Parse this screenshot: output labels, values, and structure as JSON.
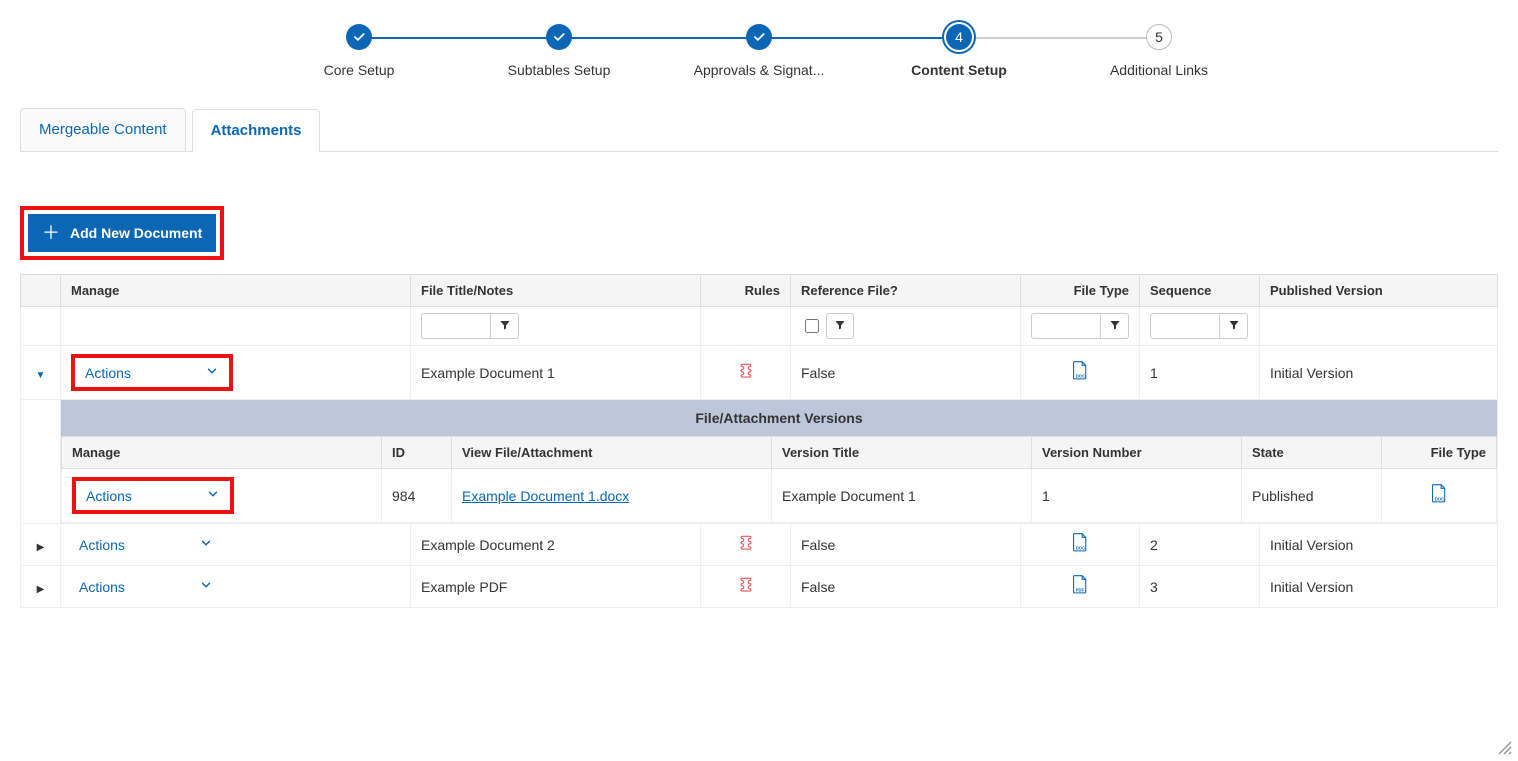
{
  "stepper": {
    "steps": [
      {
        "label": "Core Setup",
        "state": "done"
      },
      {
        "label": "Subtables Setup",
        "state": "done"
      },
      {
        "label": "Approvals & Signat...",
        "state": "done"
      },
      {
        "label": "Content Setup",
        "state": "active",
        "num": "4"
      },
      {
        "label": "Additional Links",
        "state": "pending",
        "num": "5"
      }
    ]
  },
  "tabs": {
    "items": [
      {
        "label": "Mergeable Content",
        "active": false
      },
      {
        "label": "Attachments",
        "active": true
      }
    ]
  },
  "add_button": {
    "label": "Add New Document"
  },
  "columns": {
    "manage": "Manage",
    "title": "File Title/Notes",
    "rules": "Rules",
    "reference": "Reference File?",
    "filetype": "File Type",
    "sequence": "Sequence",
    "published": "Published Version"
  },
  "actions_label": "Actions",
  "rows": [
    {
      "expanded": true,
      "highlight_actions": true,
      "title": "Example Document 1",
      "reference": "False",
      "filetype": "doc",
      "sequence": "1",
      "published": "Initial Version"
    },
    {
      "expanded": false,
      "highlight_actions": false,
      "title": "Example Document 2",
      "reference": "False",
      "filetype": "doc",
      "sequence": "2",
      "published": "Initial Version"
    },
    {
      "expanded": false,
      "highlight_actions": false,
      "title": "Example PDF",
      "reference": "False",
      "filetype": "pdf",
      "sequence": "3",
      "published": "Initial Version"
    }
  ],
  "versions": {
    "title": "File/Attachment Versions",
    "columns": {
      "manage": "Manage",
      "id": "ID",
      "view": "View File/Attachment",
      "vtitle": "Version Title",
      "vnum": "Version Number",
      "state": "State",
      "filetype": "File Type"
    },
    "rows": [
      {
        "highlight_actions": true,
        "id": "984",
        "view": "Example Document 1.docx",
        "vtitle": "Example Document 1",
        "vnum": "1",
        "state": "Published",
        "filetype": "doc"
      }
    ]
  }
}
